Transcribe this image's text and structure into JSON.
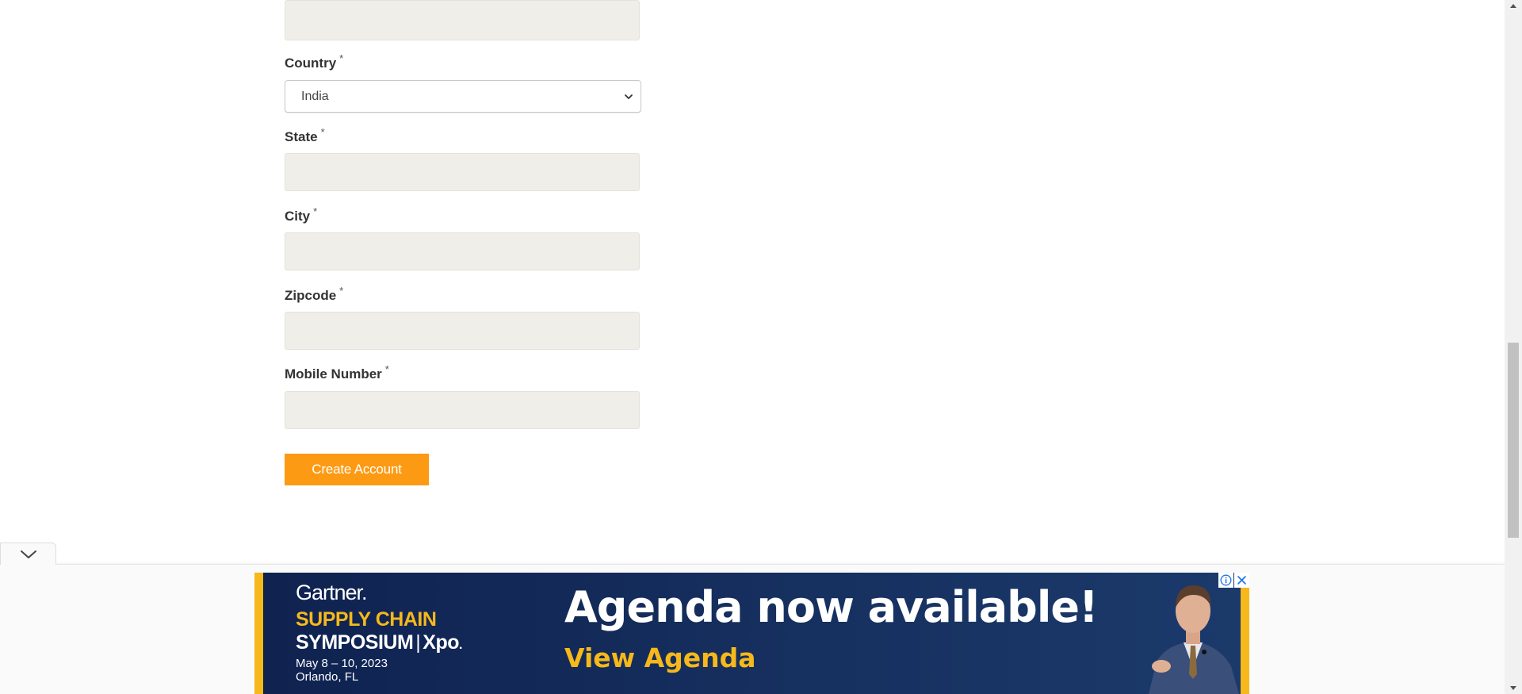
{
  "form": {
    "country": {
      "label": "Country",
      "required_mark": "*",
      "selected": "India"
    },
    "state": {
      "label": "State",
      "required_mark": "*",
      "value": ""
    },
    "city": {
      "label": "City",
      "required_mark": "*",
      "value": ""
    },
    "zipcode": {
      "label": "Zipcode",
      "required_mark": "*",
      "value": ""
    },
    "mobile": {
      "label": "Mobile Number",
      "required_mark": "*",
      "value": ""
    },
    "submit_label": "Create Account"
  },
  "ad": {
    "brand": "Gartner",
    "brand_dot": ".",
    "event_line1": "SUPPLY CHAIN",
    "event_line2_a": "SYMPOSIUM",
    "event_line2_sep": "|",
    "event_line2_b": "Xpo",
    "event_line2_dot": ".",
    "date": "May 8 – 10, 2023",
    "place": "Orlando, FL",
    "headline": "Agenda now available!",
    "cta": "View Agenda",
    "accent_color": "#f6b81a",
    "background_color": "#16305f"
  },
  "colors": {
    "button": "#fd9a13",
    "input_bg": "#efeee9"
  }
}
